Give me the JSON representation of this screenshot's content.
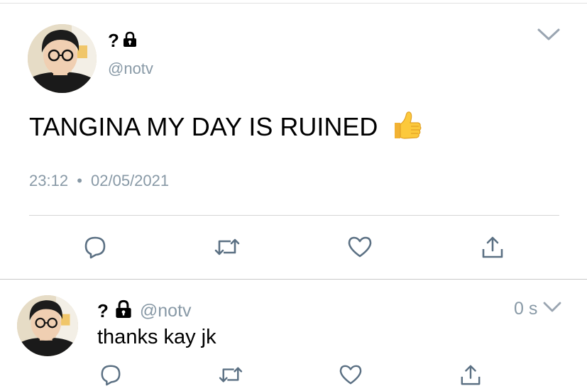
{
  "main_tweet": {
    "display_name": "?",
    "handle": "@notv",
    "text": "TANGINA MY DAY IS RUINED",
    "emoji": "👍",
    "time": "23:12",
    "separator": "•",
    "date": "02/05/2021",
    "icons": {
      "lock": "lock-icon",
      "menu": "chevron-down-icon",
      "reply": "reply-icon",
      "retweet": "retweet-icon",
      "like": "heart-icon",
      "share": "share-icon"
    }
  },
  "reply_tweet": {
    "display_name": "?",
    "handle": "@notv",
    "text": "thanks kay jk",
    "elapsed": "0 s"
  },
  "colors": {
    "secondary_text": "#8899a6",
    "icon": "#5b7083",
    "divider": "#d6d6d6"
  }
}
